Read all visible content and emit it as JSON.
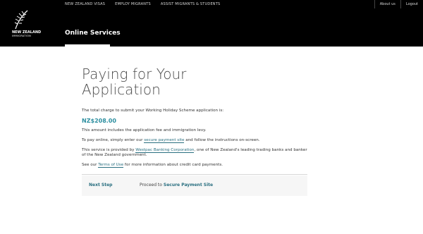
{
  "topnav": {
    "items": [
      "NEW ZEALAND VISAS",
      "EMPLOY MIGRANTS",
      "ASSIST MIGRANTS & STUDENTS"
    ]
  },
  "toplinks": {
    "about": "About us",
    "logout": "Logout"
  },
  "logo": {
    "line1": "NEW ZEALAND",
    "line2": "IMMIGRATION"
  },
  "section_title": "Online Services",
  "page": {
    "title_line1": "Paying for Your",
    "title_line2": "Application",
    "intro": "The total charge to submit your Working Holiday Scheme application is:",
    "amount": "NZ$208.00",
    "includes": "This amount includes the application fee and immigration levy.",
    "pay_prefix": "To pay online, simply enter our",
    "pay_link": "secure payment site",
    "pay_suffix": "and follow the instructions on-screen.",
    "service_prefix": "This service is provided by",
    "service_link": "Westpac Banking Corporation",
    "service_suffix": ", one of New Zealand's leading trading banks and banker of the New Zealand government.",
    "terms_prefix": "See our",
    "terms_link": "Terms of Use",
    "terms_suffix": "for more information about credit card payments."
  },
  "next": {
    "label": "Next Step",
    "text_prefix": "Proceed to",
    "link": "Secure Payment Site"
  },
  "colors": {
    "accent": "#2d8fa0",
    "header_bg": "#000000"
  }
}
